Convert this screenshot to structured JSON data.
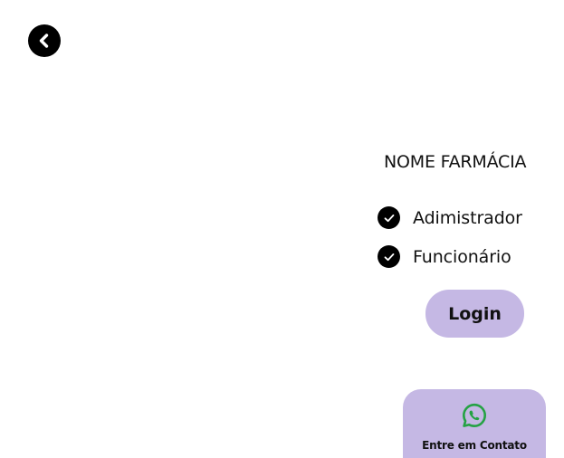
{
  "header": {
    "back_icon": "chevron-left-icon"
  },
  "pharmacy": {
    "name": "NOME FARMÁCIA"
  },
  "roles": {
    "options": [
      {
        "label": "Adimistrador",
        "icon": "check-circle-icon"
      },
      {
        "label": "Funcionário",
        "icon": "check-circle-icon"
      }
    ]
  },
  "actions": {
    "login_label": "Login",
    "contact_label": "Entre em Contato",
    "contact_icon": "whatsapp-icon"
  },
  "colors": {
    "button_bg": "#c5b8e4",
    "whatsapp_green": "#25a244",
    "icon_black": "#000000"
  }
}
